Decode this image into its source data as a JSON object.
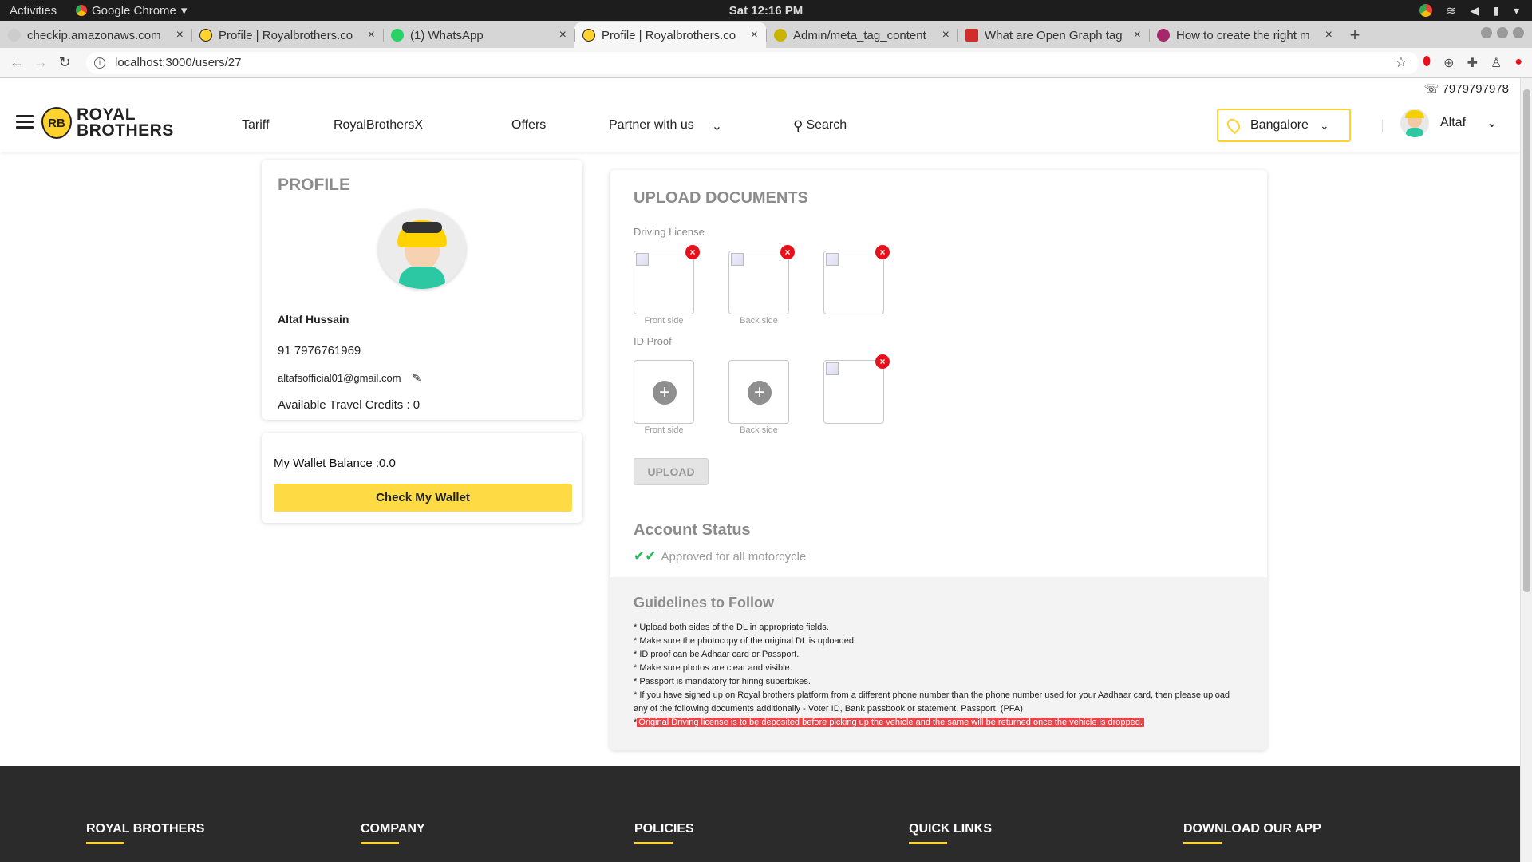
{
  "system": {
    "activities": "Activities",
    "app_name": "Google Chrome",
    "clock": "Sat 12:16 PM"
  },
  "tabs": [
    {
      "title": "checkip.amazonaws.com",
      "fav_color": "#cccccc",
      "active": false
    },
    {
      "title": "Profile | Royalbrothers.co",
      "fav_color": "#ffd22e",
      "active": false
    },
    {
      "title": "(1) WhatsApp",
      "fav_color": "#25d366",
      "active": false
    },
    {
      "title": "Profile | Royalbrothers.co",
      "fav_color": "#ffd22e",
      "active": true
    },
    {
      "title": "Admin/meta_tag_content",
      "fav_color": "#c9b400",
      "active": false
    },
    {
      "title": "What are Open Graph tag",
      "fav_color": "#d22d2d",
      "active": false
    },
    {
      "title": "How to create the right m",
      "fav_color": "#a4286a",
      "active": false
    }
  ],
  "address": {
    "url": "localhost:3000/users/27"
  },
  "header": {
    "phone": "7979797978",
    "logo_badge": "RB",
    "logo_line1": "ROYAL",
    "logo_line2": "BROTHERS",
    "nav": [
      "Tariff",
      "RoyalBrothersX",
      "Offers",
      "Partner with us"
    ],
    "search_label": "Search",
    "city": "Bangalore",
    "user_name": "Altaf"
  },
  "profile": {
    "heading": "PROFILE",
    "name": "Altaf Hussain",
    "phone": "91 7976761969",
    "email": "altafsofficial01@gmail.com",
    "credits": "Available Travel Credits : 0"
  },
  "wallet": {
    "balance_label": "My Wallet Balance :0.0",
    "button": "Check My Wallet"
  },
  "documents": {
    "heading": "UPLOAD DOCUMENTS",
    "dl_label": "Driving License",
    "id_label": "ID Proof",
    "front_side": "Front side",
    "back_side": "Back side",
    "upload_button": "UPLOAD",
    "account_status_heading": "Account Status",
    "account_status": "Approved for all motorcycle"
  },
  "guidelines": {
    "heading": "Guidelines to Follow",
    "items": [
      "* Upload both sides of the DL in appropriate fields.",
      "* Make sure the photocopy of the original DL is uploaded.",
      "* ID proof can be Adhaar card or Passport.",
      "* Make sure photos are clear and visible.",
      "* Passport is mandatory for hiring superbikes.",
      "* If you have signed up on Royal brothers platform from a different phone number than the phone number used for your Aadhaar card, then please upload any of the following documents additionally - Voter ID, Bank passbook or statement, Passport. (PFA)"
    ],
    "highlight_prefix": "*",
    "highlight": "Original Driving license is to be deposited before picking up the vehicle and the same will be returned once the vehicle is dropped."
  },
  "footer": {
    "columns": [
      "ROYAL BROTHERS",
      "COMPANY",
      "POLICIES",
      "QUICK LINKS",
      "DOWNLOAD OUR APP"
    ]
  },
  "colors": {
    "brand_yellow": "#ffd22e",
    "remove_red": "#e8101a",
    "approved_green": "#27b85a",
    "footer_bg": "#2b2b2b"
  }
}
